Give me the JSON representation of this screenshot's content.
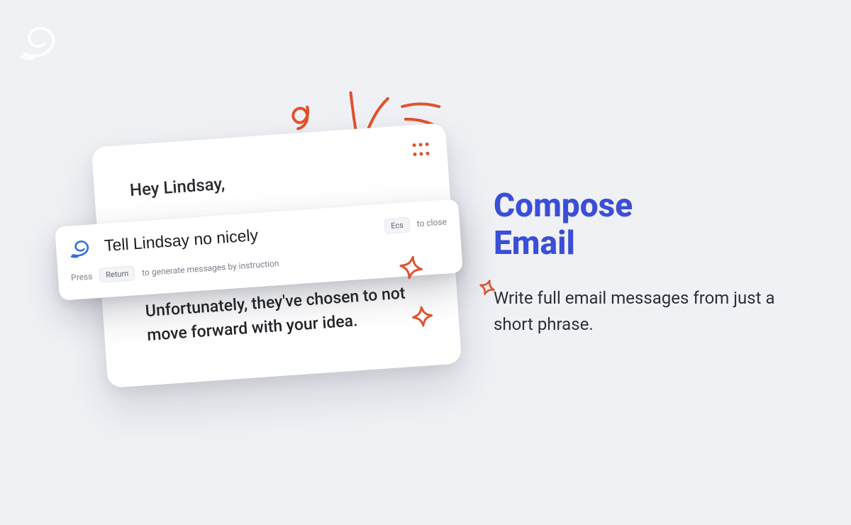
{
  "marketing": {
    "heading_line1": "Compose",
    "heading_line2": "Email",
    "subheading": "Write full email messages from just a short phrase."
  },
  "emailCard": {
    "greeting": "Hey Lindsay,",
    "body": "Unfortunately, they've chosen to not move forward with your idea."
  },
  "commandBar": {
    "input_value": "Tell Lindsay no nicely",
    "close_key": "Ecs",
    "close_label": "to close",
    "hint_prefix": "Press",
    "hint_key": "Return",
    "hint_suffix": "to generate messages by instruction"
  },
  "icons": {
    "corner_logo": "swirl-logo-icon",
    "app_logo": "swirl-logo-icon",
    "drag": "drag-handle-icon",
    "sparkle": "sparkle-icon",
    "flourish": "flourish-icon"
  }
}
